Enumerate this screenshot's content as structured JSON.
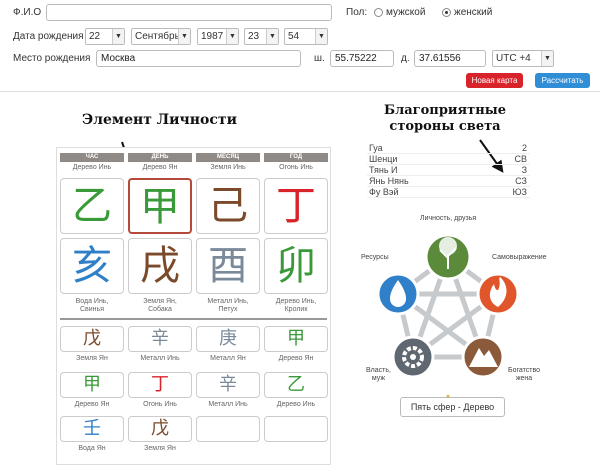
{
  "form": {
    "fio_label": "Ф.И.О",
    "fio_value": "",
    "gender_label": "Пол:",
    "gender_male": "мужской",
    "gender_female": "женский",
    "birth_date_label": "Дата рождения",
    "day": "22",
    "month": "Сентябрь",
    "year": "1987",
    "hour": "23",
    "minute": "54",
    "birthplace_label": "Место рождения",
    "birthplace_value": "Москва",
    "lat_label": "ш.",
    "lat_value": "55.75222",
    "lon_label": "д.",
    "lon_value": "37.61556",
    "timezone": "UTC +4",
    "new_card_button": "Новая карта",
    "calculate_button": "Рассчитать"
  },
  "annotations": {
    "personality_element": "Элемент Личности",
    "favorable_directions": "Благоприятные стороны света"
  },
  "pillars": {
    "headers": [
      "ЧАС",
      "ДЕНЬ",
      "МЕСЯЦ",
      "ГОД"
    ],
    "stem_labels": [
      "Дерево Инь",
      "Дерево Ян",
      "Земля Инь",
      "Огонь Инь"
    ],
    "stems": [
      {
        "char": "乙",
        "color": "#3a9a3a"
      },
      {
        "char": "甲",
        "color": "#3a9a3a"
      },
      {
        "char": "己",
        "color": "#7a4a2a"
      },
      {
        "char": "丁",
        "color": "#d8232a"
      }
    ],
    "branches": [
      {
        "char": "亥",
        "color": "#2f80c8"
      },
      {
        "char": "戌",
        "color": "#7a4a2a"
      },
      {
        "char": "酉",
        "color": "#7a8a9a"
      },
      {
        "char": "卯",
        "color": "#3a9a3a"
      }
    ],
    "branch_labels": [
      [
        "Вода Инь,",
        "Свинья"
      ],
      [
        "Земля Ян,",
        "Собака"
      ],
      [
        "Металл Инь,",
        "Петух"
      ],
      [
        "Дерево Инь,",
        "Кролик"
      ]
    ],
    "hidden": [
      [
        {
          "char": "戊",
          "color": "#7a4a2a",
          "label": "Земля Ян"
        },
        {
          "char": "甲",
          "color": "#3a9a3a",
          "label": "Дерево Ян"
        },
        {
          "char": "壬",
          "color": "#2f80c8",
          "label": "Вода Ян"
        }
      ],
      [
        {
          "char": "辛",
          "color": "#7a8a9a",
          "label": "Металл Инь"
        },
        {
          "char": "丁",
          "color": "#d8232a",
          "label": "Огонь Инь"
        },
        {
          "char": "戊",
          "color": "#7a4a2a",
          "label": "Земля Ян"
        }
      ],
      [
        {
          "char": "庚",
          "color": "#7a8a9a",
          "label": "Металл Ян"
        },
        {
          "char": "辛",
          "color": "#7a8a9a",
          "label": "Металл Инь"
        }
      ],
      [
        {
          "char": "甲",
          "color": "#3a9a3a",
          "label": "Дерево Ян"
        },
        {
          "char": "乙",
          "color": "#3a9a3a",
          "label": "Дерево Инь"
        }
      ]
    ]
  },
  "directions": [
    {
      "key": "Гуа",
      "value": "2"
    },
    {
      "key": "Шенци",
      "value": "СВ"
    },
    {
      "key": "Тянь И",
      "value": "З"
    },
    {
      "key": "Янь Нянь",
      "value": "СЗ"
    },
    {
      "key": "Фу Вэй",
      "value": "ЮЗ"
    }
  ],
  "wheel": {
    "labels": {
      "top": "Личность, друзья",
      "left": "Ресурсы",
      "right": "Самовыражение",
      "bottom_left": [
        "Власть,",
        "муж"
      ],
      "bottom_right": [
        "Богатство",
        "жена"
      ]
    },
    "colors": {
      "wood": "#5a8a3a",
      "water": "#2f80c8",
      "fire": "#e0562a",
      "metal": "#5f6770",
      "earth": "#8a5a3a"
    },
    "footer_button": "Пять сфер - Дерево"
  }
}
